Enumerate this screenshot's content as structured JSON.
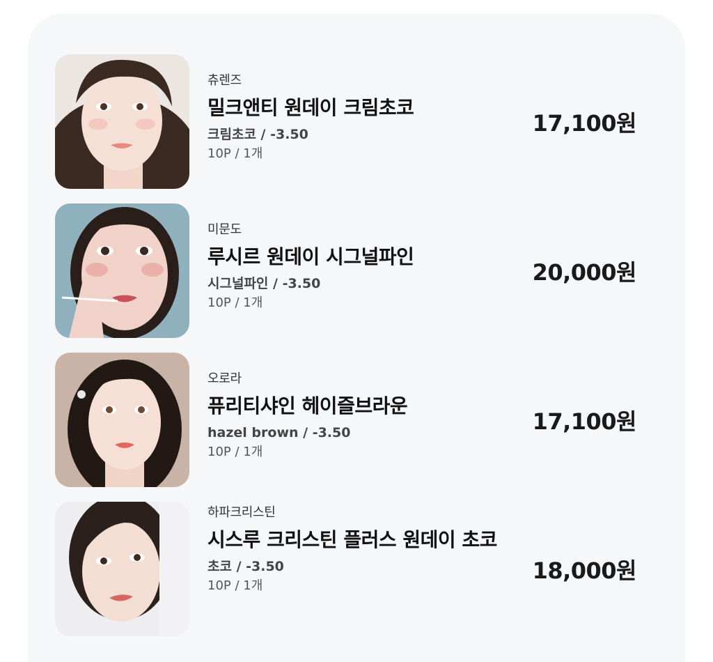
{
  "cart": {
    "items": [
      {
        "brand": "츄렌즈",
        "name": "밀크앤티 원데이 크림초코",
        "option": "크림초코 / -3.50",
        "quantity": "10P / 1개",
        "price": "17,100원",
        "image_icon": "product-model-photo"
      },
      {
        "brand": "미문도",
        "name": "루시르 원데이 시그널파인",
        "option": "시그널파인 / -3.50",
        "quantity": "10P / 1개",
        "price": "20,000원",
        "image_icon": "product-model-photo"
      },
      {
        "brand": "오로라",
        "name": "퓨리티샤인 헤이즐브라운",
        "option": "hazel brown / -3.50",
        "quantity": "10P / 1개",
        "price": "17,100원",
        "image_icon": "product-model-photo"
      },
      {
        "brand": "하파크리스틴",
        "name": "시스루 크리스틴 플러스 원데이 초코",
        "option": "초코 / -3.50",
        "quantity": "10P / 1개",
        "price": "18,000원",
        "image_icon": "product-model-photo"
      }
    ]
  },
  "colors": {
    "panel_background": "#f6f7f9",
    "text_primary": "#111111",
    "text_secondary": "#555555"
  }
}
